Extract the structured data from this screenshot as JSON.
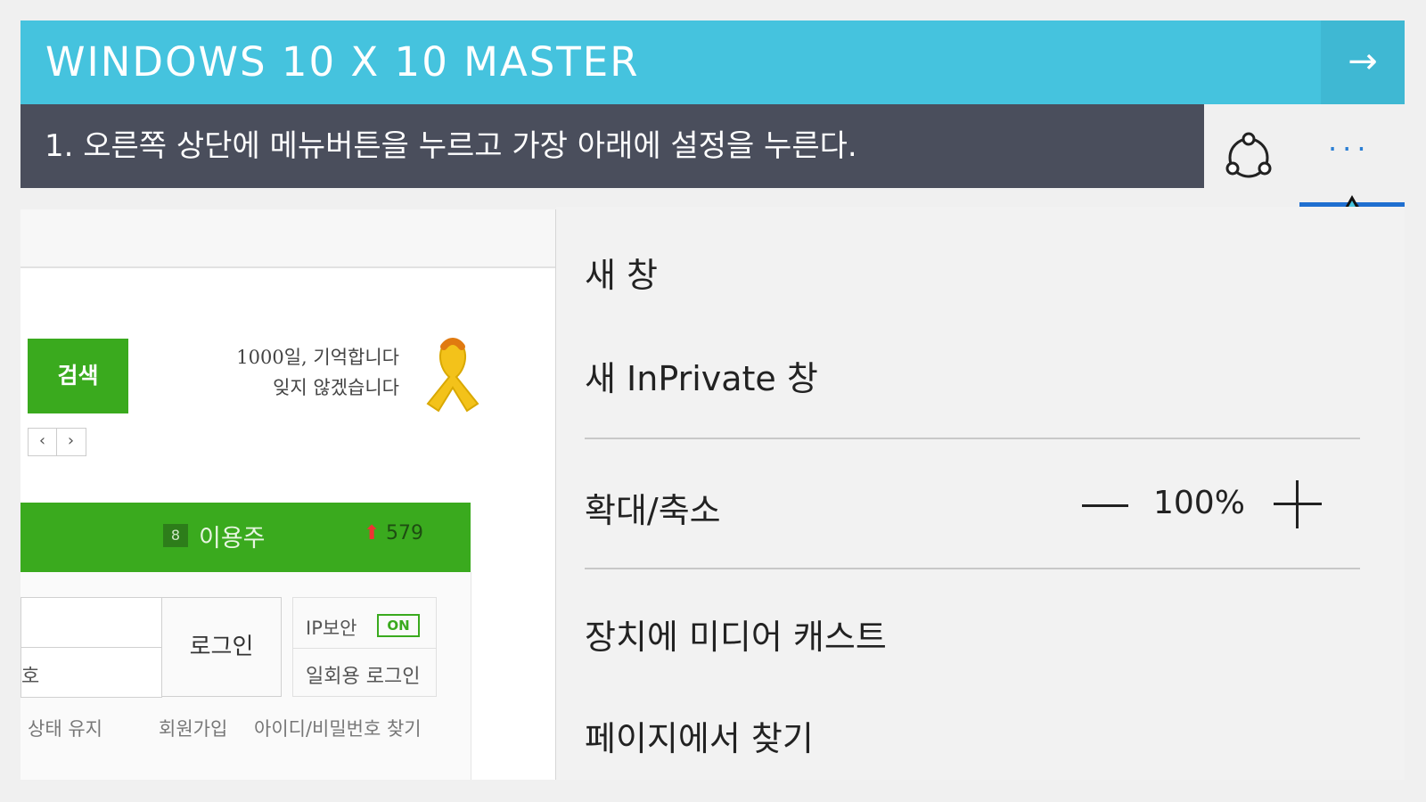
{
  "title_bar": {
    "title": "WINDOWS 10 X 10 MASTER",
    "next_glyph": "→"
  },
  "instruction": {
    "text": "1. 오른쪽 상단에 메뉴버튼을 누르고 가장 아래에 설정을 누른다."
  },
  "browser_toolbar": {
    "more_glyph": "···",
    "share_icon": "share-icon",
    "more_icon": "more-dots-icon",
    "accent": "#1f6fd0"
  },
  "webpage": {
    "search_button": "검색",
    "ribbon_line1": "1000일, 기억합니다",
    "ribbon_line2": "잊지 않겠습니다",
    "pager": {
      "prev": "‹",
      "next": "›"
    },
    "rank": {
      "badge": "8",
      "word": "이용주",
      "arrow": "⬆",
      "count": "579"
    },
    "login": {
      "pw_label": "호",
      "login_button": "로그인",
      "ip_security": "IP보안",
      "ip_on": "ON",
      "otp_login": "일회용 로그인",
      "stay_logged": "상태 유지",
      "signup": "회원가입",
      "find_id_pw": "아이디/비밀번호 찾기"
    },
    "colors": {
      "green": "#3aaa1e"
    }
  },
  "menu": {
    "new_window": "새 창",
    "new_inprivate": "새 InPrivate 창",
    "zoom_label": "확대/축소",
    "zoom_value": "100%",
    "cast": "장치에 미디어 캐스트",
    "find": "페이지에서 찾기"
  },
  "colors": {
    "title_bar": "#45c3de",
    "instruction_bar": "#4a4e5c",
    "arrow": "#45c3de"
  }
}
